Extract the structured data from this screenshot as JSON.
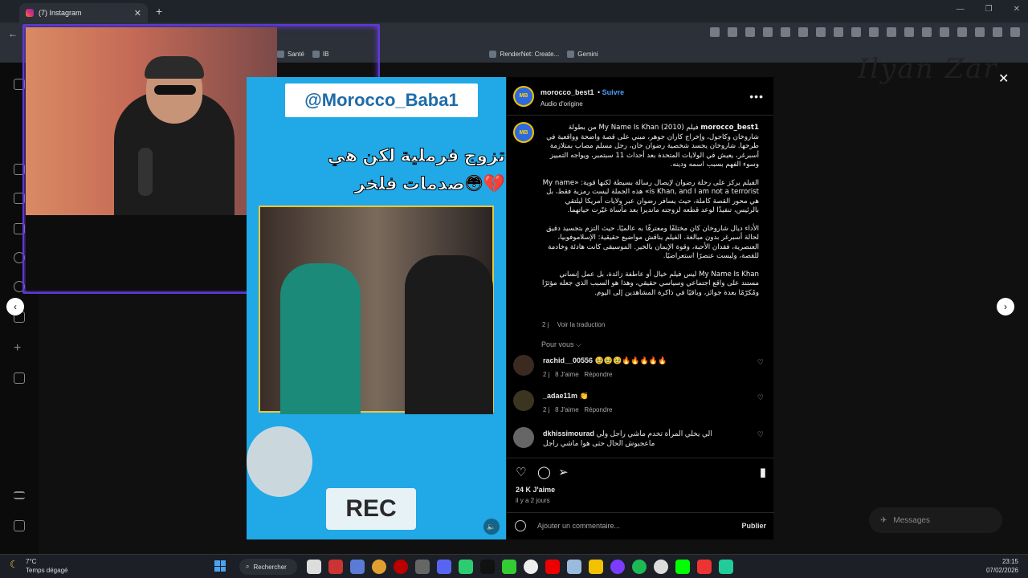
{
  "browser": {
    "tab_title": "(7) Instagram",
    "tab_close": "✕",
    "new_tab": "+",
    "back": "←",
    "bookmarks": [
      "Santé",
      "IB",
      "RenderNet: Create...",
      "Gemini"
    ]
  },
  "overlay": {
    "watermark": "Ilyan Zar",
    "close": "✕",
    "prev": "‹",
    "next": "›"
  },
  "video": {
    "banner": "@Morocco_Baba1",
    "title": "تزوج فرملية لكن هي صدمات فلخر😳💔",
    "rec": "REC"
  },
  "post": {
    "username": "morocco_best1",
    "follow": "Suivre",
    "audio": "Audio d'origine",
    "more": "•••",
    "avatar_text": "MB",
    "caption": [
      "فيلم My Name Is Khan (2010) من بطولة شاروخان وكاجول، وإخراج كاران جوهر، مبني على قصة واضحة وواقعية في طرحها. شاروخان يجسد شخصية رضوان خان، رجل مسلم مصاب بمتلازمة أسبرغر، يعيش في الولايات المتحدة بعد أحداث 11 سبتمبر، ويواجه التمييز وسوء الفهم بسبب اسمه ودينه.",
      "الفيلم يركز على رحلة رضوان لإيصال رسالة بسيطة لكنها قوية: «My name is Khan, and I am not a terrorist» هذه الجملة ليست رمزية فقط، بل هي محور القصة كاملة، حيث يسافر رضوان عبر ولايات أمريكا ليلتقي بالرئيس، تنفيذًا لوعد قطعه لزوجته مانديرا بعد مأساة غيّرت حياتهما.",
      "الأداء ديال شاروخان كان مختلفًا ومعترفًا به عالميًا، حيث التزم بتجسيد دقيق لحالة أسبرغر بدون مبالغة. الفيلم يناقش مواضيع حقيقية: الإسلاموفوبيا، العنصرية، فقدان الأحبة، وقوة الإيمان بالخير. الموسيقى كانت هادئة وخادمة للقصة، وليست عنصرًا استعراضيًا.",
      "My Name Is Khan ليس فيلم خيال أو عاطفة زائدة، بل عمل إنساني مستند على واقع اجتماعي وسياسي حقيقي، وهذا هو السبب الذي جعله مؤثرًا ومُكرّمًا بعدة جوائز، وباقيًا في ذاكرة المشاهدين إلى اليوم."
    ],
    "caption_time": "2 j",
    "see_translation": "Voir la traduction",
    "for_you": "Pour vous ⌵",
    "comments": [
      {
        "user": "rachid__00556",
        "text": "🥹🥹🥹🔥🔥🔥🔥🔥",
        "time": "2 j",
        "likes": "8 J'aime",
        "reply": "Répondre"
      },
      {
        "user": "_adae11m",
        "text": "👏",
        "time": "2 j",
        "likes": "8 J'aime",
        "reply": "Répondre"
      },
      {
        "user": "dkhissimourad",
        "text": "الي يخلي المرأة تخدم ماشي راجل ولي ماعجبوش الحال حتى هوا ماشي راجل",
        "time": "",
        "likes": "",
        "reply": ""
      }
    ],
    "likes": "24 K J'aime",
    "ago": "il y a 2 jours",
    "add_comment": "Ajouter un commentaire...",
    "publish": "Publier"
  },
  "messages": "Messages",
  "taskbar": {
    "temp": "7°C",
    "weather": "Temps dégagé",
    "search": "Rechercher",
    "time": "23:15",
    "date": "07/02/2026"
  }
}
